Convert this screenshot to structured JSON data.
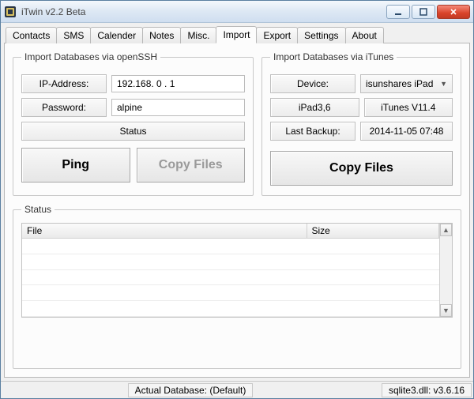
{
  "titlebar": {
    "title": "iTwin v2.2 Beta"
  },
  "tabs": [
    {
      "label": "Contacts"
    },
    {
      "label": "SMS"
    },
    {
      "label": "Calender"
    },
    {
      "label": "Notes"
    },
    {
      "label": "Misc."
    },
    {
      "label": "Import"
    },
    {
      "label": "Export"
    },
    {
      "label": "Settings"
    },
    {
      "label": "About"
    }
  ],
  "active_tab_index": 5,
  "ssh": {
    "legend": "Import Databases via openSSH",
    "ip_label": "IP-Address:",
    "ip_value": "192.168. 0 . 1",
    "pwd_label": "Password:",
    "pwd_value": "alpine",
    "status_label": "Status",
    "ping_btn": "Ping",
    "copy_btn": "Copy Files"
  },
  "itunes": {
    "legend": "Import Databases via iTunes",
    "device_label": "Device:",
    "device_selected": "isunshares iPad",
    "model": "iPad3,6",
    "version": "iTunes V11.4",
    "backup_label": "Last Backup:",
    "backup_value": "2014-11-05   07:48",
    "copy_btn": "Copy Files"
  },
  "status_table": {
    "legend": "Status",
    "col_file": "File",
    "col_size": "Size"
  },
  "statusbar": {
    "db": "Actual Database: (Default)",
    "sqlite": "sqlite3.dll: v3.6.16"
  }
}
